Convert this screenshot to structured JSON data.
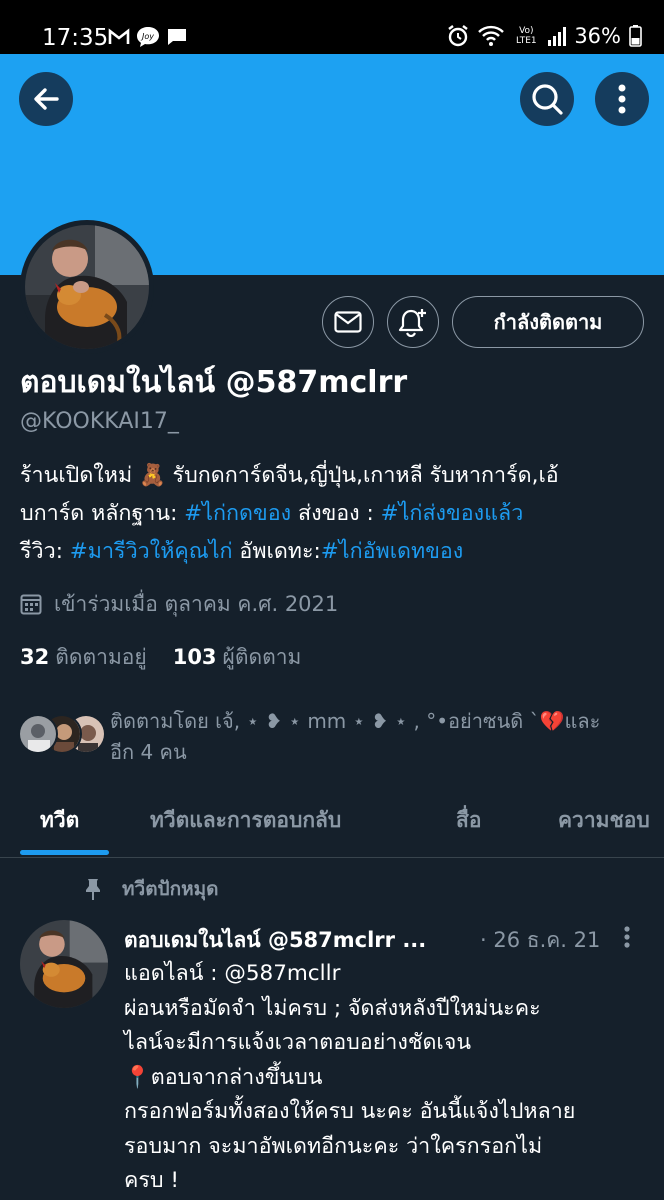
{
  "status_bar": {
    "time": "17:35",
    "battery": "36%",
    "network": "Vo) LTE1"
  },
  "profile": {
    "display_name": "ตอบเดมในไลน์ @587mclrr",
    "handle": "@KOOKKAI17_",
    "following_button": "กำลังติดตาม",
    "bio_lines": [
      [
        {
          "text": "ร้านเปิดใหม่ 🧸 รับกดการ์ดจีน,ญี่ปุ่น,เกาหลี รับหาการ์ด,เอ้",
          "tag": false
        }
      ],
      [
        {
          "text": "บการ์ด หลักฐาน: ",
          "tag": false
        },
        {
          "text": "#ไก่กดของ",
          "tag": true
        },
        {
          "text": " ส่งของ : ",
          "tag": false
        },
        {
          "text": "#ไก่ส่งของแล้ว",
          "tag": true
        }
      ],
      [
        {
          "text": "รีวิว: ",
          "tag": false
        },
        {
          "text": "#มารีวิวให้คุณไก่",
          "tag": true
        },
        {
          "text": " อัพเดทะ:",
          "tag": false
        },
        {
          "text": "#ไก่อัพเดทของ",
          "tag": true
        }
      ]
    ],
    "joined": "เข้าร่วมเมื่อ ตุลาคม ค.ศ. 2021",
    "following_count": "32",
    "following_label": "ติดตามอยู่",
    "followers_count": "103",
    "followers_label": "ผู้ติดตาม",
    "followed_by_line1": "ติดตามโดย เจ้, ⋆ ❥ ⋆  mm  ⋆ ❥ ⋆ , °•อย่าซนดิ `💔และ",
    "followed_by_line2": "อีก 4 คน"
  },
  "tabs": [
    {
      "label": "ทวีต",
      "active": true
    },
    {
      "label": "ทวีตและการตอบกลับ",
      "active": false
    },
    {
      "label": "สื่อ",
      "active": false
    },
    {
      "label": "ความชอบ",
      "active": false
    }
  ],
  "pinned_label": "ทวีตปักหมุด",
  "tweet": {
    "name": "ตอบเดมในไลน์ @587mclrr ...",
    "date": "· 26 ธ.ค. 21",
    "lines": [
      "แอดไลน์ : @587mcllr",
      "ผ่อนหรือมัดจำ ไม่ครบ ; จัดส่งหลังปีใหม่นะคะ",
      "ไลน์จะมีการแจ้งเวลาตอบอย่างชัดเจน",
      "📍ตอบจากล่างขึ้นบน",
      "กรอกฟอร์มทั้งสองให้ครบ นะคะ อันนี้แจ้งไปหลาย",
      "รอบมาก จะมาอัพเดทอีกนะคะ ว่าใครกรอกไม่",
      "ครบ !"
    ]
  },
  "colors": {
    "background": "#15202b",
    "banner": "#1da1f2",
    "accent": "#1d9bf0",
    "secondary_text": "#8b98a5"
  }
}
